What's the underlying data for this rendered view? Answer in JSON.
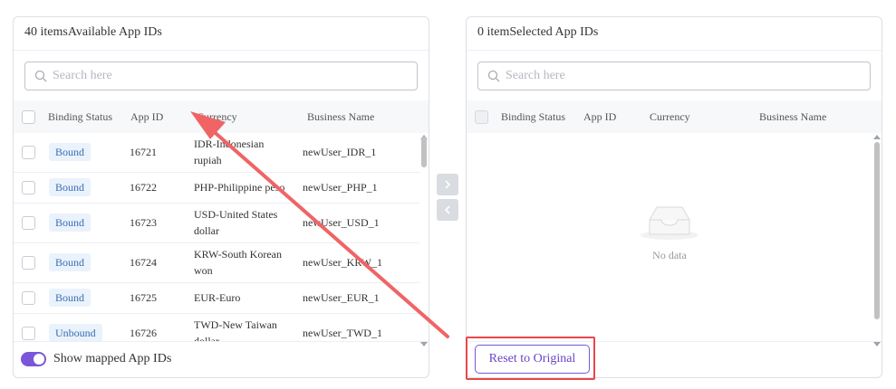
{
  "left_panel": {
    "count": "40 items",
    "title": "Available App IDs",
    "search_placeholder": "Search here",
    "columns": [
      "Binding Status",
      "App ID",
      "Currency",
      "Business Name"
    ],
    "rows": [
      {
        "status": "Bound",
        "app_id": "16721",
        "currency": [
          "IDR-Indonesian",
          "rupiah"
        ],
        "business": "newUser_IDR_1"
      },
      {
        "status": "Bound",
        "app_id": "16722",
        "currency": [
          "PHP-Philippine peso"
        ],
        "business": "newUser_PHP_1"
      },
      {
        "status": "Bound",
        "app_id": "16723",
        "currency": [
          "USD-United States",
          "dollar"
        ],
        "business": "newUser_USD_1"
      },
      {
        "status": "Bound",
        "app_id": "16724",
        "currency": [
          "KRW-South Korean",
          "won"
        ],
        "business": "newUser_KRW_1"
      },
      {
        "status": "Bound",
        "app_id": "16725",
        "currency": [
          "EUR-Euro"
        ],
        "business": "newUser_EUR_1"
      },
      {
        "status": "Unbound",
        "app_id": "16726",
        "currency": [
          "TWD-New Taiwan",
          "dollar"
        ],
        "business": "newUser_TWD_1"
      }
    ],
    "toggle_label": "Show mapped App IDs",
    "toggle_on": true
  },
  "right_panel": {
    "count": "0 item",
    "title": "Selected App IDs",
    "search_placeholder": "Search here",
    "columns": [
      "Binding Status",
      "App ID",
      "Currency",
      "Business Name"
    ],
    "empty_text": "No data",
    "reset_label": "Reset to Original"
  },
  "colors": {
    "accent": "#7b56d9",
    "badge_bg": "#eaf2fc",
    "badge_text": "#3a6fb5",
    "highlight": "#e8474a"
  }
}
